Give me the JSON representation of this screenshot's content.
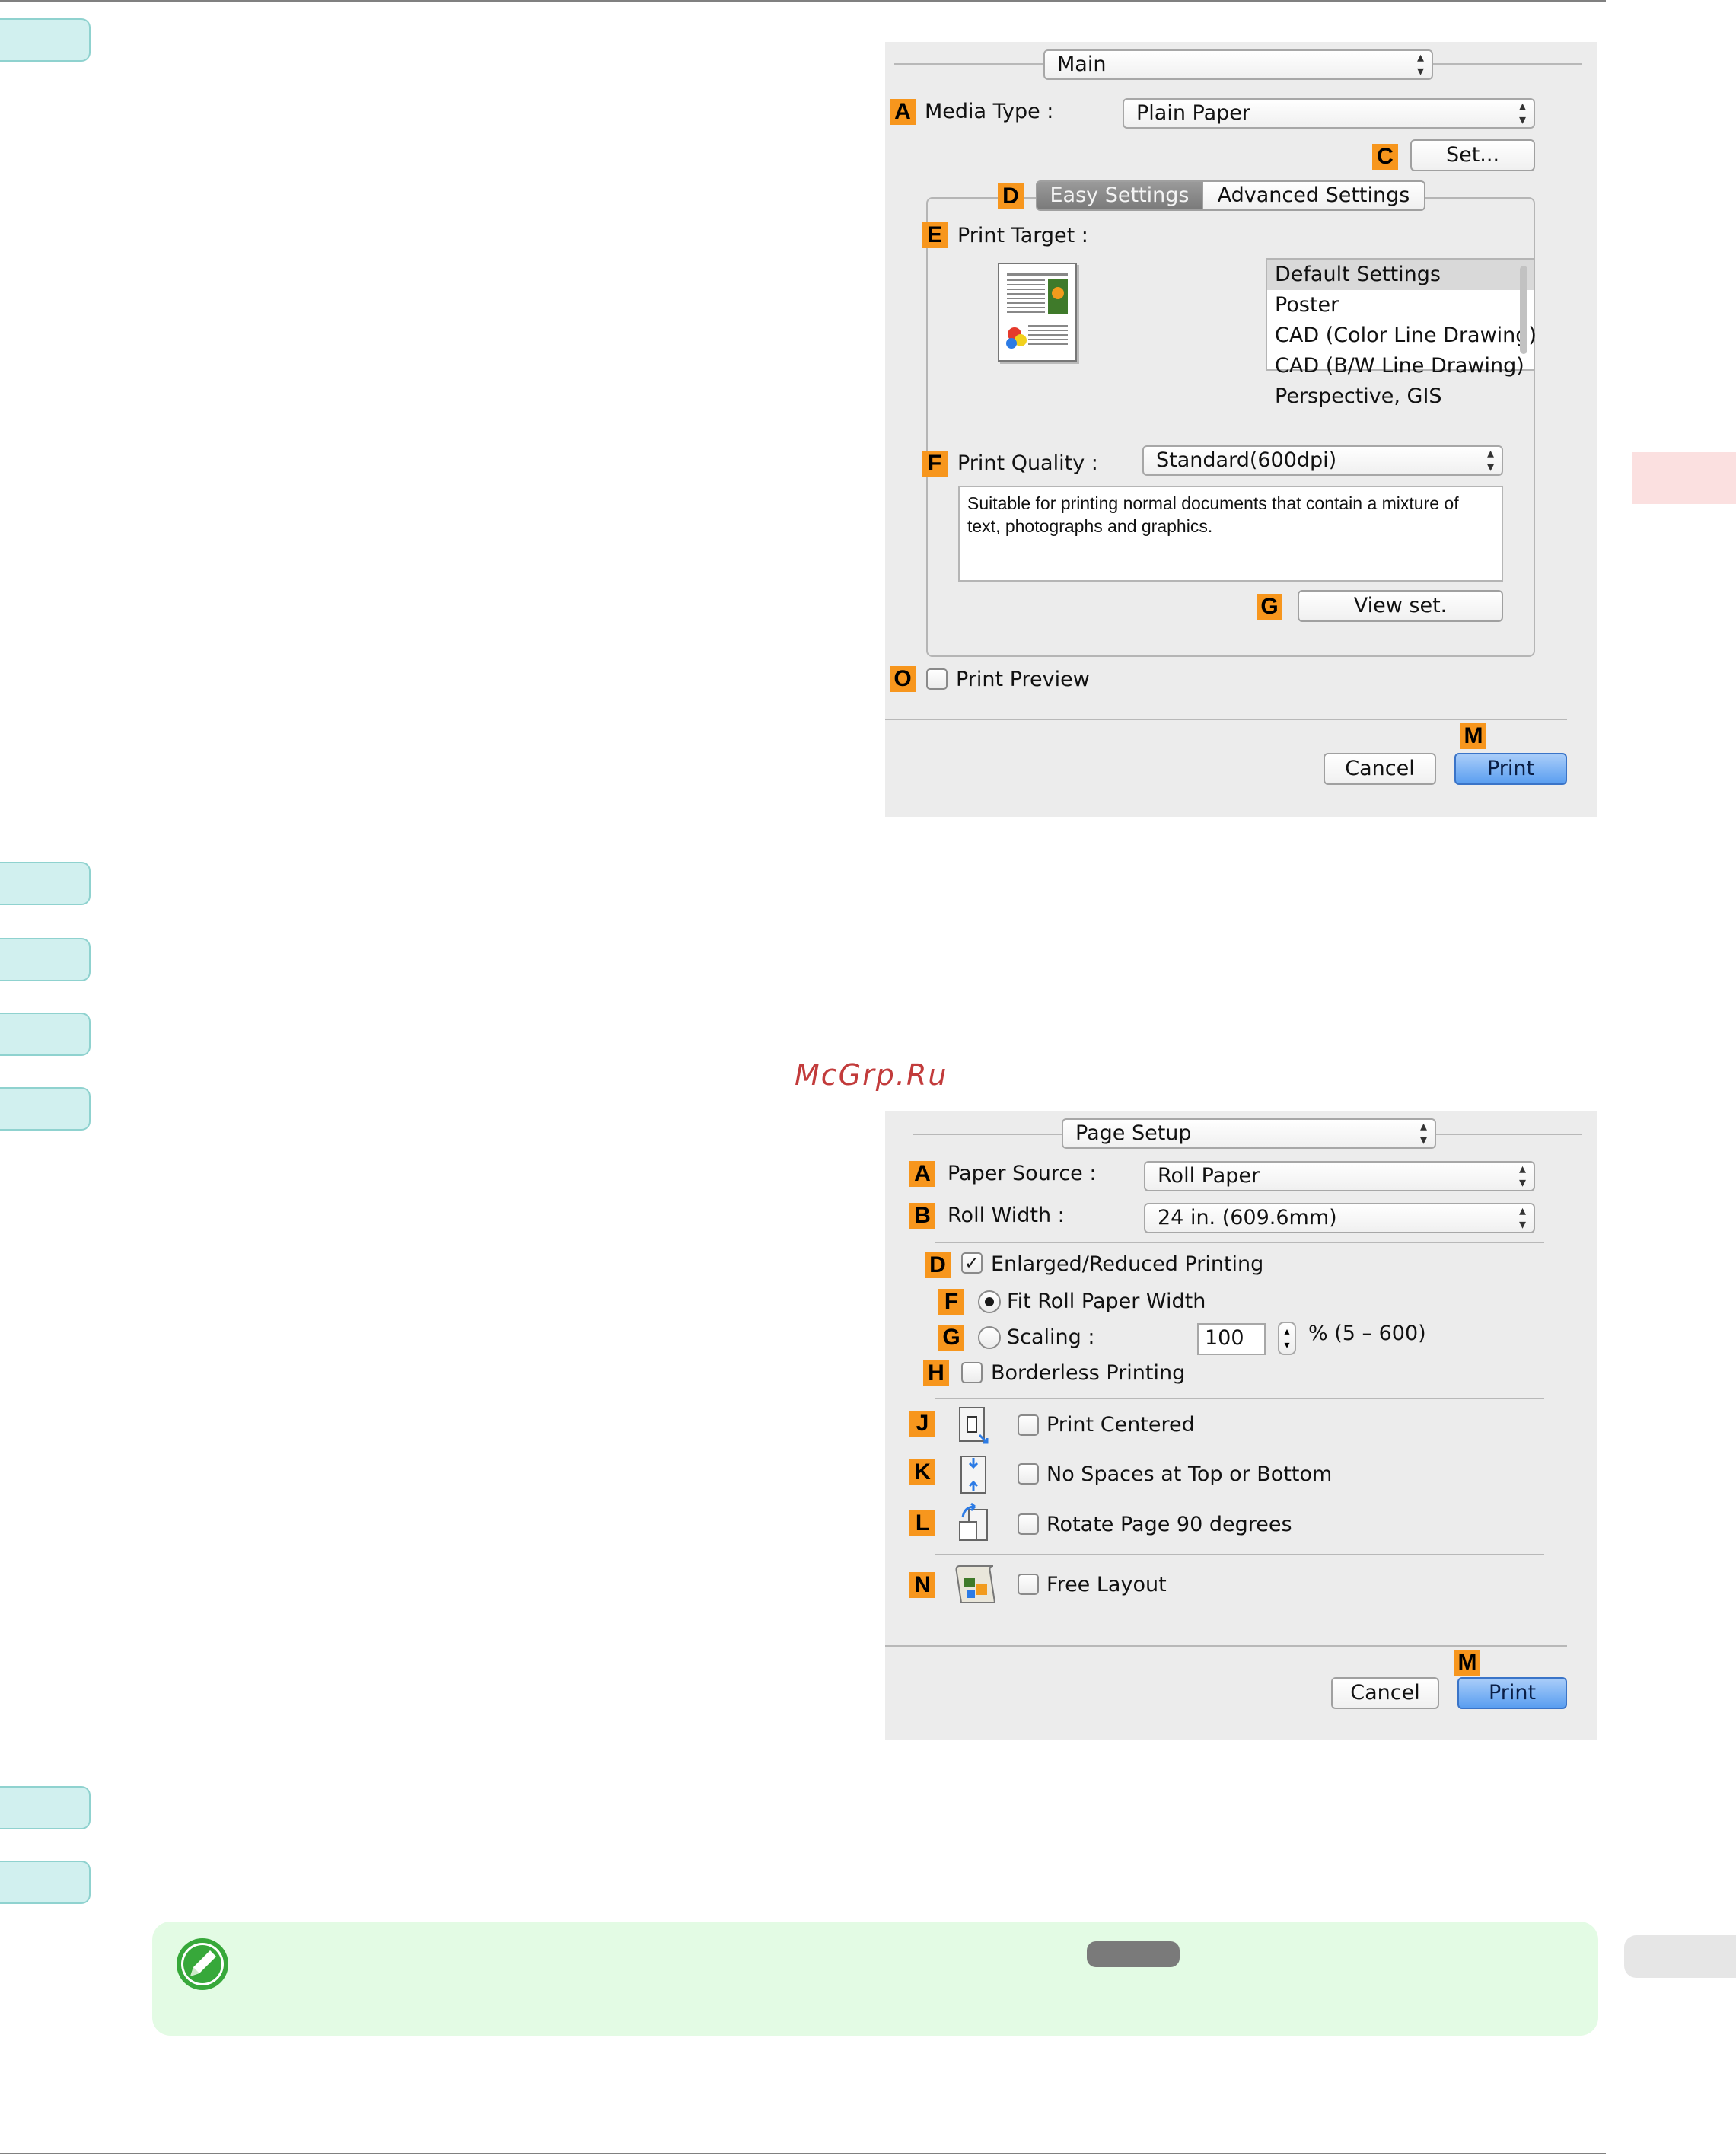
{
  "watermark": "McGrp.Ru",
  "main_dialog": {
    "panel_select": "Main",
    "media_type_label": "Media Type :",
    "media_type_value": "Plain Paper",
    "set_button": "Set...",
    "tabs": [
      "Easy Settings",
      "Advanced Settings"
    ],
    "print_target_label": "Print Target :",
    "print_targets": [
      "Default Settings",
      "Poster",
      "CAD (Color Line Drawing)",
      "CAD (B/W Line Drawing)",
      "Perspective, GIS"
    ],
    "print_quality_label": "Print Quality :",
    "print_quality_value": "Standard(600dpi)",
    "description": "Suitable for printing normal documents that contain a mixture of text, photographs and graphics.",
    "view_set_button": "View set.",
    "print_preview_label": "Print Preview",
    "cancel_button": "Cancel",
    "print_button": "Print",
    "markers": {
      "a": "A",
      "c": "C",
      "d": "D",
      "e": "E",
      "f": "F",
      "g": "G",
      "o": "O",
      "m": "M"
    }
  },
  "page_setup_dialog": {
    "panel_select": "Page Setup",
    "paper_source_label": "Paper Source :",
    "paper_source_value": "Roll Paper",
    "roll_width_label": "Roll Width :",
    "roll_width_value": "24 in. (609.6mm)",
    "enlarged_label": "Enlarged/Reduced Printing",
    "fit_roll_label": "Fit Roll Paper Width",
    "scaling_label": "Scaling :",
    "scaling_value": "100",
    "scaling_range": "% (5 – 600)",
    "borderless_label": "Borderless Printing",
    "print_centered_label": "Print Centered",
    "no_spaces_label": "No Spaces at Top or Bottom",
    "rotate_label": "Rotate Page 90 degrees",
    "free_layout_label": "Free Layout",
    "cancel_button": "Cancel",
    "print_button": "Print",
    "markers": {
      "a": "A",
      "b": "B",
      "d": "D",
      "f": "F",
      "g": "G",
      "h": "H",
      "j": "J",
      "k": "K",
      "l": "L",
      "n": "N",
      "m": "M"
    },
    "enlarged_checked": true,
    "fit_roll_selected": true
  },
  "colors": {
    "step_tab": "#d1f0ef",
    "marker": "#f7961d",
    "dialog_bg": "#ececec",
    "note_bg": "#e3fbe4",
    "print_button": "#5a9ef0"
  }
}
